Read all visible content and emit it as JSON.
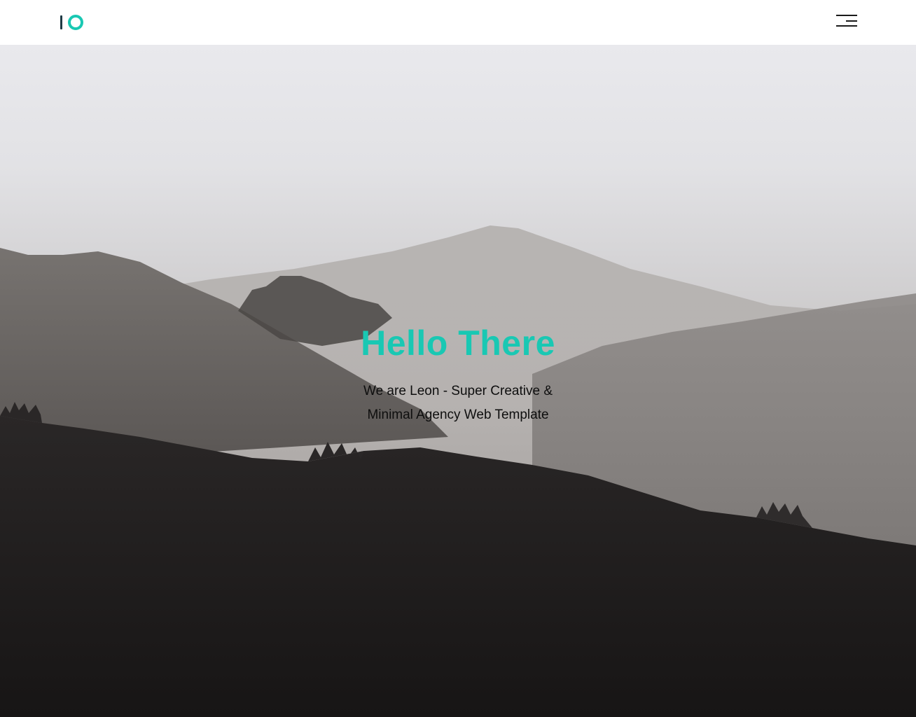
{
  "header": {
    "logo_icon": "leon-logo-icon",
    "menu_icon": "hamburger-menu-icon"
  },
  "hero": {
    "title": "Hello There",
    "subtitle": "We are Leon - Super Creative & Minimal Agency Web Template",
    "title_color": "#19c8b3",
    "background": "misty mountain forest landscape"
  },
  "colors": {
    "accent": "#19c8b3",
    "header_bg": "#ffffff",
    "text_dark": "#0e0e0e"
  }
}
